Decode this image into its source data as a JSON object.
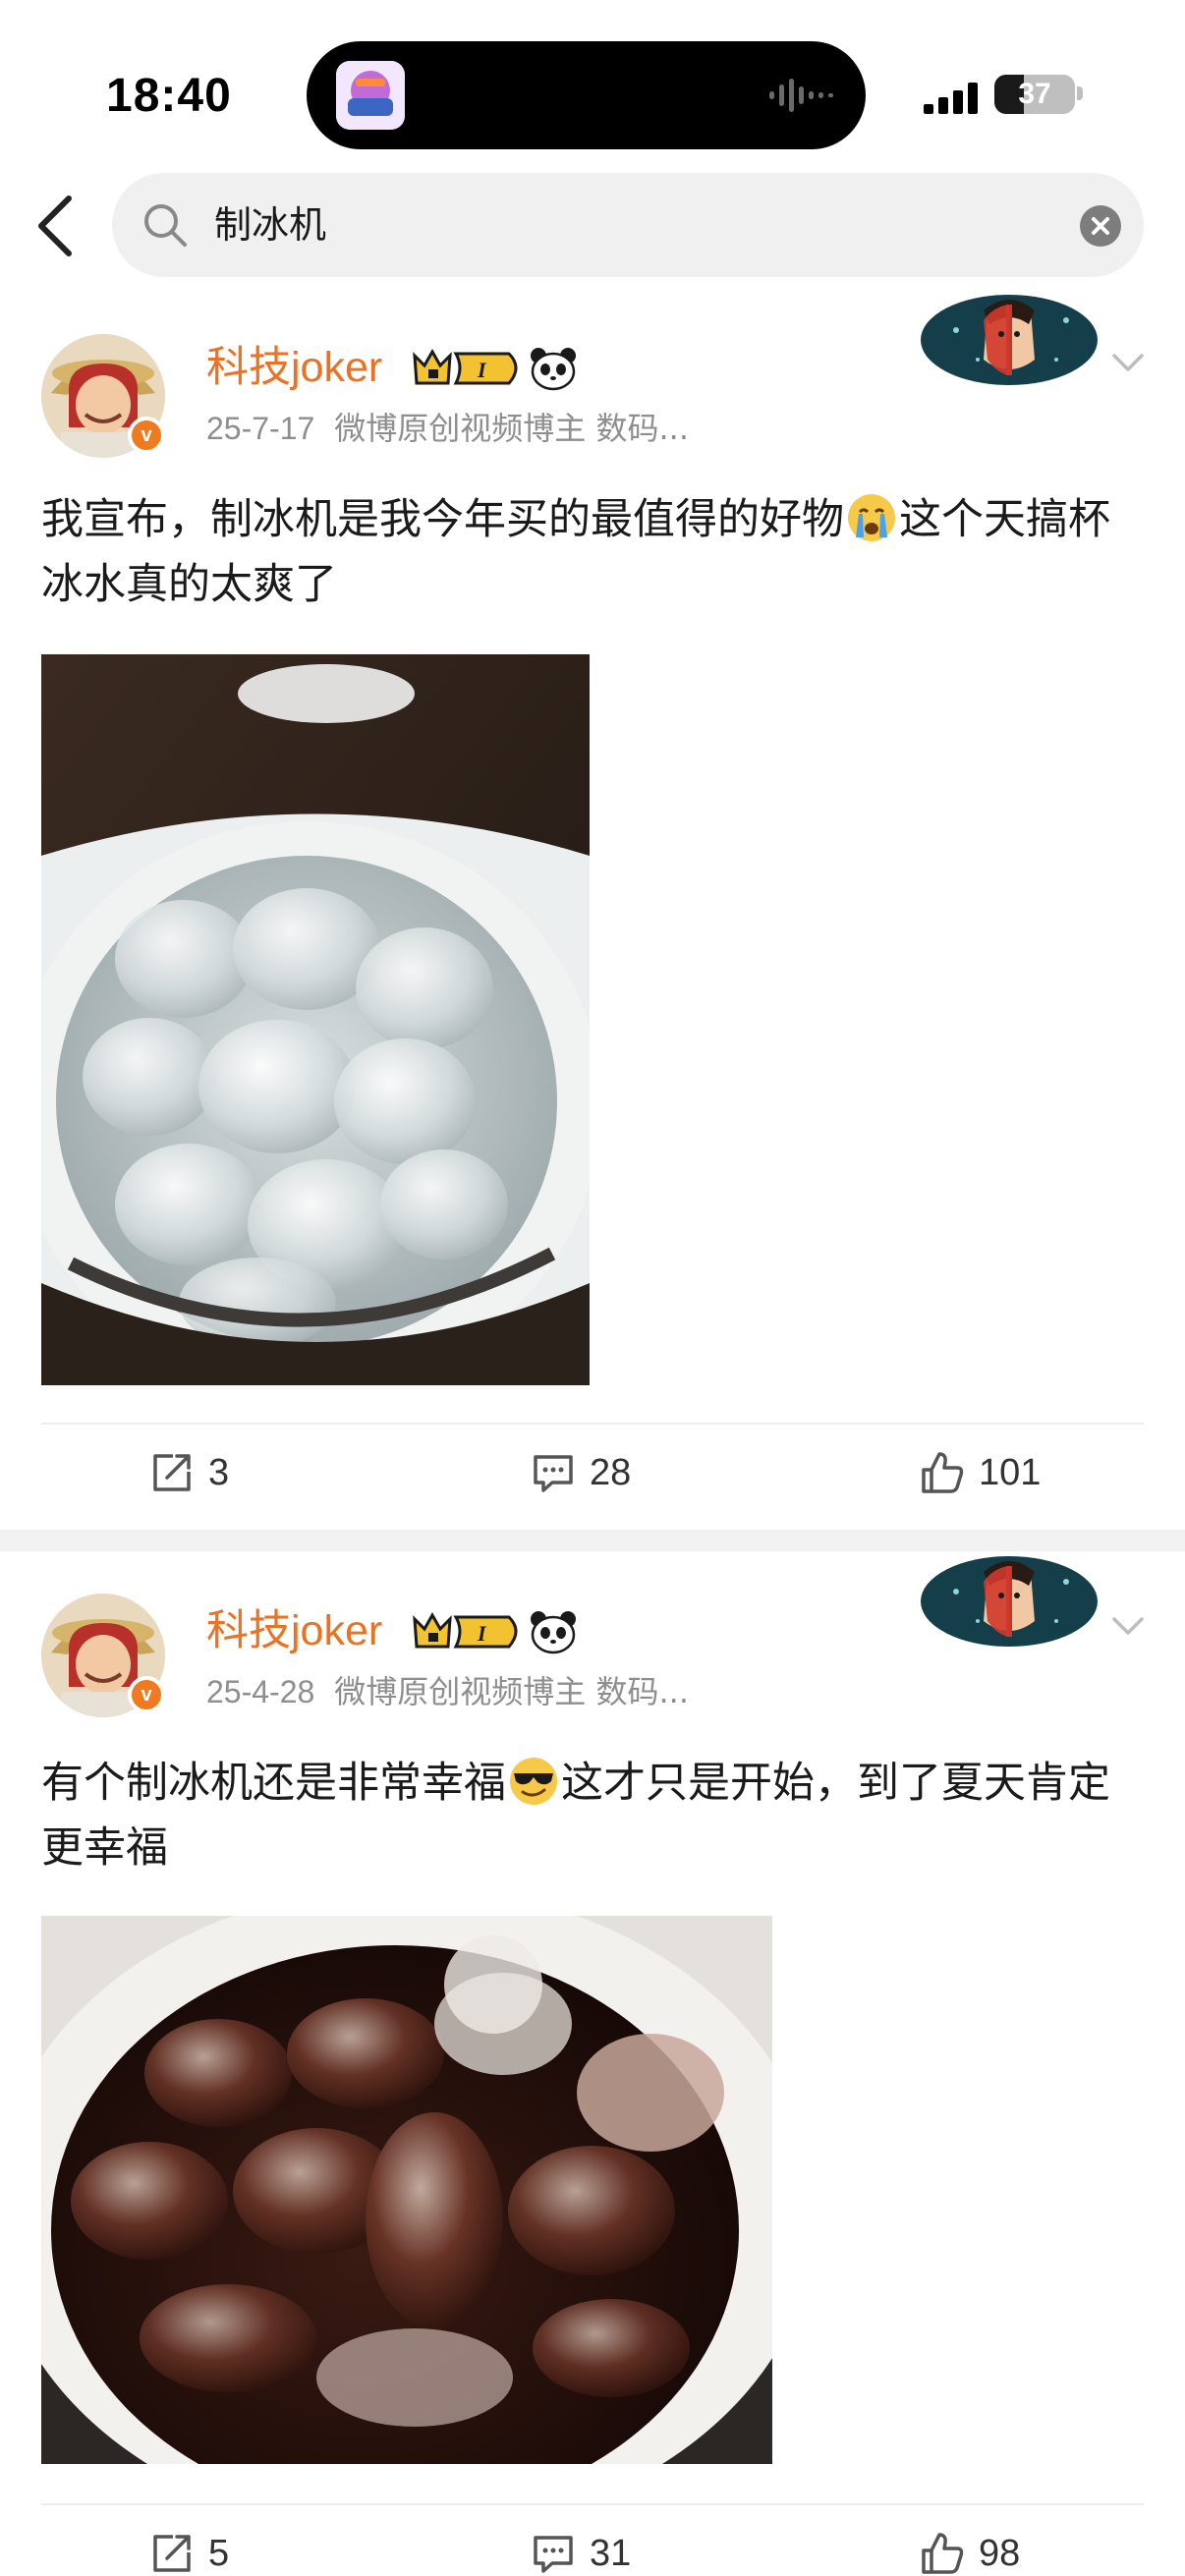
{
  "status_bar": {
    "time": "18:40",
    "battery": "37",
    "battery_level": 0.37,
    "island_app_icon": "podcast-app-icon",
    "island_activity_icon": "audio-waveform-icon"
  },
  "search": {
    "query": "制冰机"
  },
  "posts": [
    {
      "username": "科技joker",
      "time": "25-7-17",
      "source": "微博原创视频博主 数码...",
      "text_before_emoji": "我宣布，制冰机是我今年买的最值得的好物",
      "emoji": "crying-face-emoji",
      "text_after_emoji": "这个天搞杯冰水真的太爽了",
      "image_desc": "ice-water-cup",
      "repost_count": "3",
      "comment_count": "28",
      "like_count": "101"
    },
    {
      "username": "科技joker",
      "time": "25-4-28",
      "source": "微博原创视频博主 数码...",
      "text_before_emoji": "有个制冰机还是非常幸福",
      "emoji": "sunglasses-face-emoji",
      "text_after_emoji": "这才只是开始，到了夏天肯定更幸福",
      "image_desc": "iced-cola-cup",
      "repost_count": "5",
      "comment_count": "31",
      "like_count": "98"
    }
  ],
  "colors": {
    "username": "#eb7223",
    "meta": "#8e8e8e",
    "verified": "#f07a1d",
    "search_bg": "#f0f0f0"
  }
}
